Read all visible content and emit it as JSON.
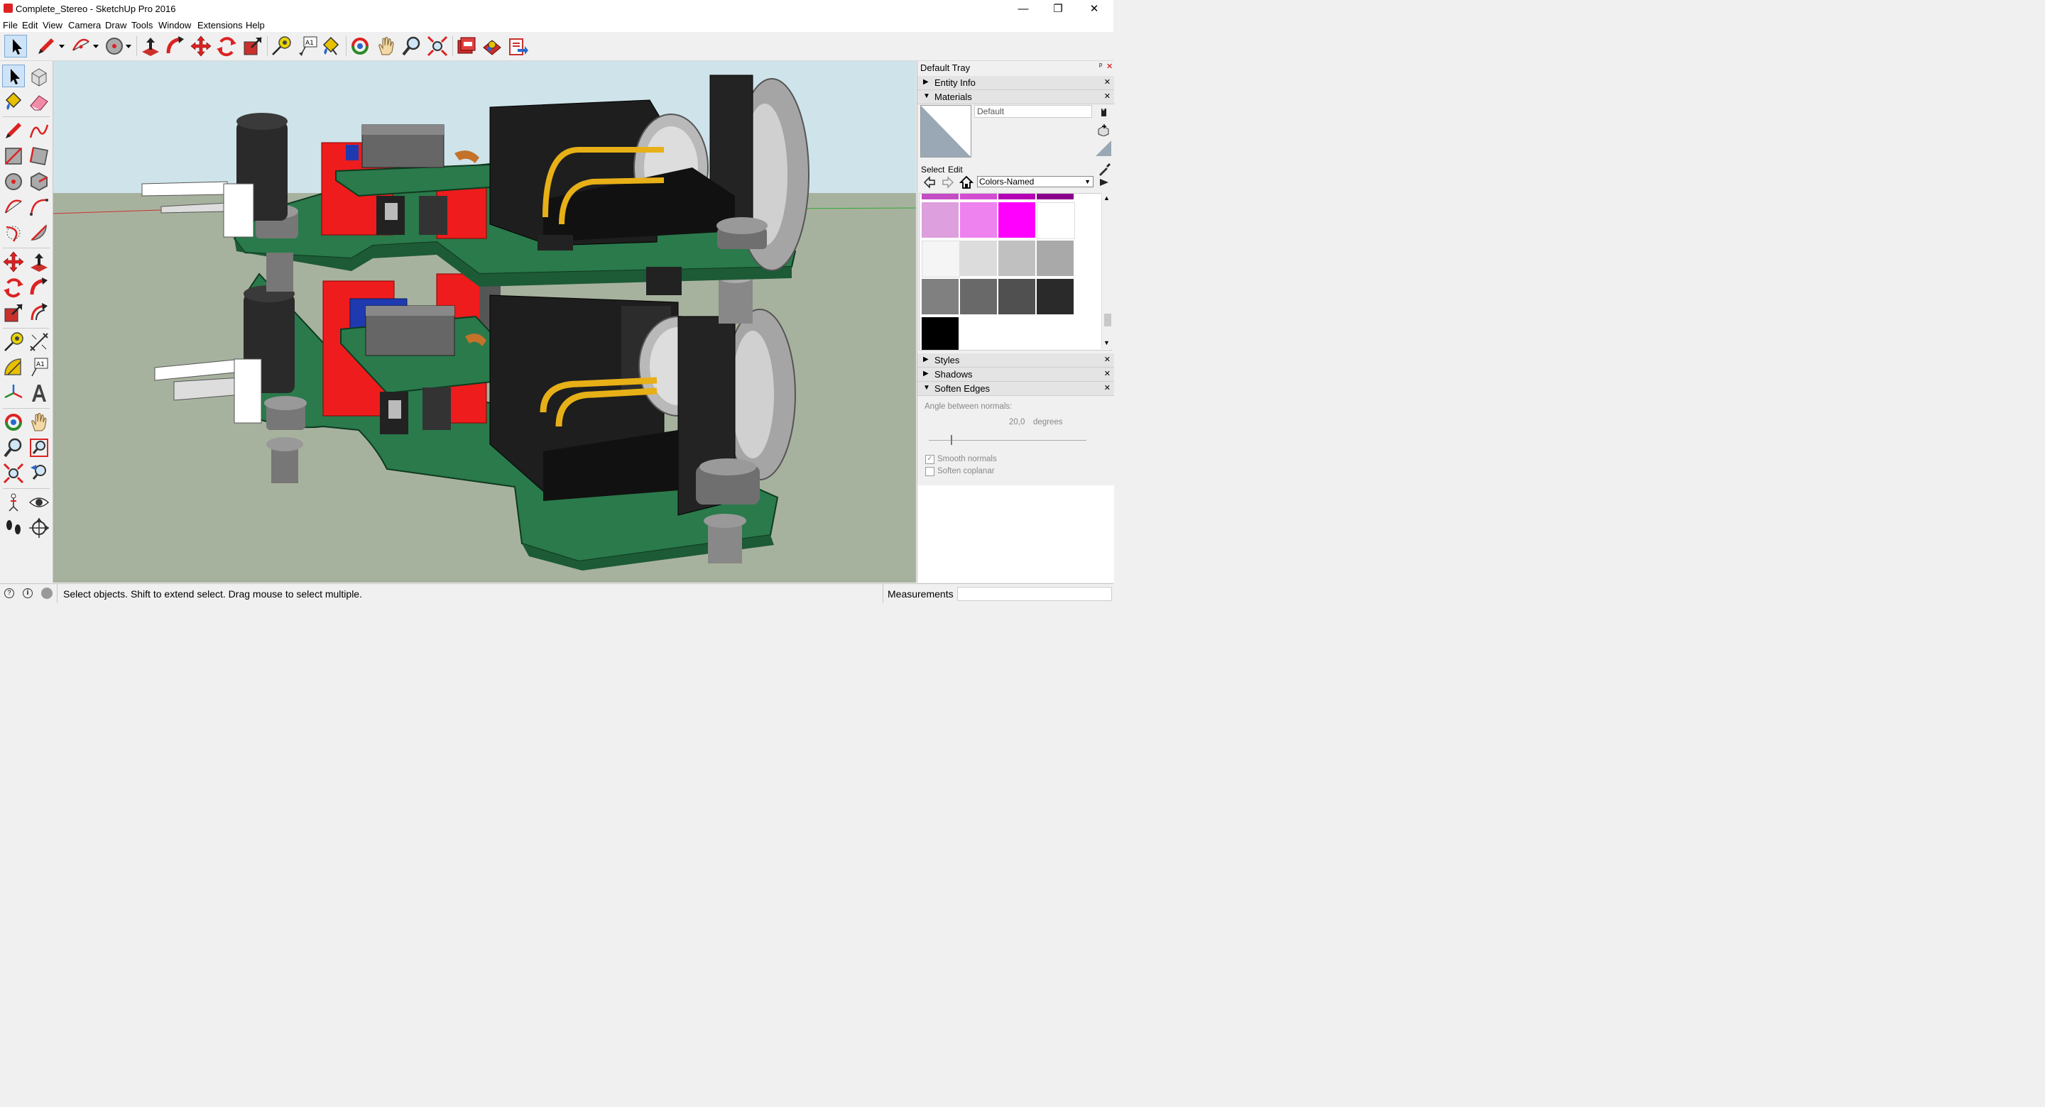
{
  "window": {
    "title": "Complete_Stereo - SketchUp Pro 2016",
    "minimize": "—",
    "restore": "❐",
    "close": "✕"
  },
  "menu": [
    "File",
    "Edit",
    "View",
    "Camera",
    "Draw",
    "Tools",
    "Window",
    "Extensions",
    "Help"
  ],
  "tray": {
    "title": "Default Tray",
    "pin": "ᵖ",
    "close": "✕",
    "panels": {
      "entity_info": "Entity Info",
      "materials": "Materials",
      "styles": "Styles",
      "shadows": "Shadows",
      "soften_edges": "Soften Edges"
    },
    "materials": {
      "name_value": "Default",
      "tab_select": "Select",
      "tab_edit": "Edit",
      "library": "Colors-Named",
      "swatches": [
        [
          "#c44cc4",
          "#d24dd2",
          "#b400b4",
          "#8a008a"
        ],
        [
          "#dd9fdd",
          "#ee82ee",
          "#ff00ff",
          "#ffffff"
        ],
        [
          "#f5f5f5",
          "#dcdcdc",
          "#c0c0c0",
          "#a9a9a9"
        ],
        [
          "#808080",
          "#696969",
          "#505050",
          "#2a2a2a"
        ],
        [
          "#000000"
        ]
      ]
    },
    "soften": {
      "angle_label": "Angle between normals:",
      "angle_value": "20,0",
      "angle_unit": "degrees",
      "smooth_normals": "Smooth normals",
      "soften_coplanar": "Soften coplanar",
      "smooth_checked": true,
      "coplanar_checked": false
    }
  },
  "status": {
    "message": "Select objects. Shift to extend select. Drag mouse to select multiple.",
    "measurements_label": "Measurements"
  },
  "colors": {
    "sky": "#cfe3ea",
    "ground": "#a7b29e",
    "pcb": "#2a7a4b",
    "component_red": "#ee1c1c",
    "connector_black": "#1e1e1e",
    "metal": "#b9b9b9",
    "gold": "#e7b017"
  }
}
